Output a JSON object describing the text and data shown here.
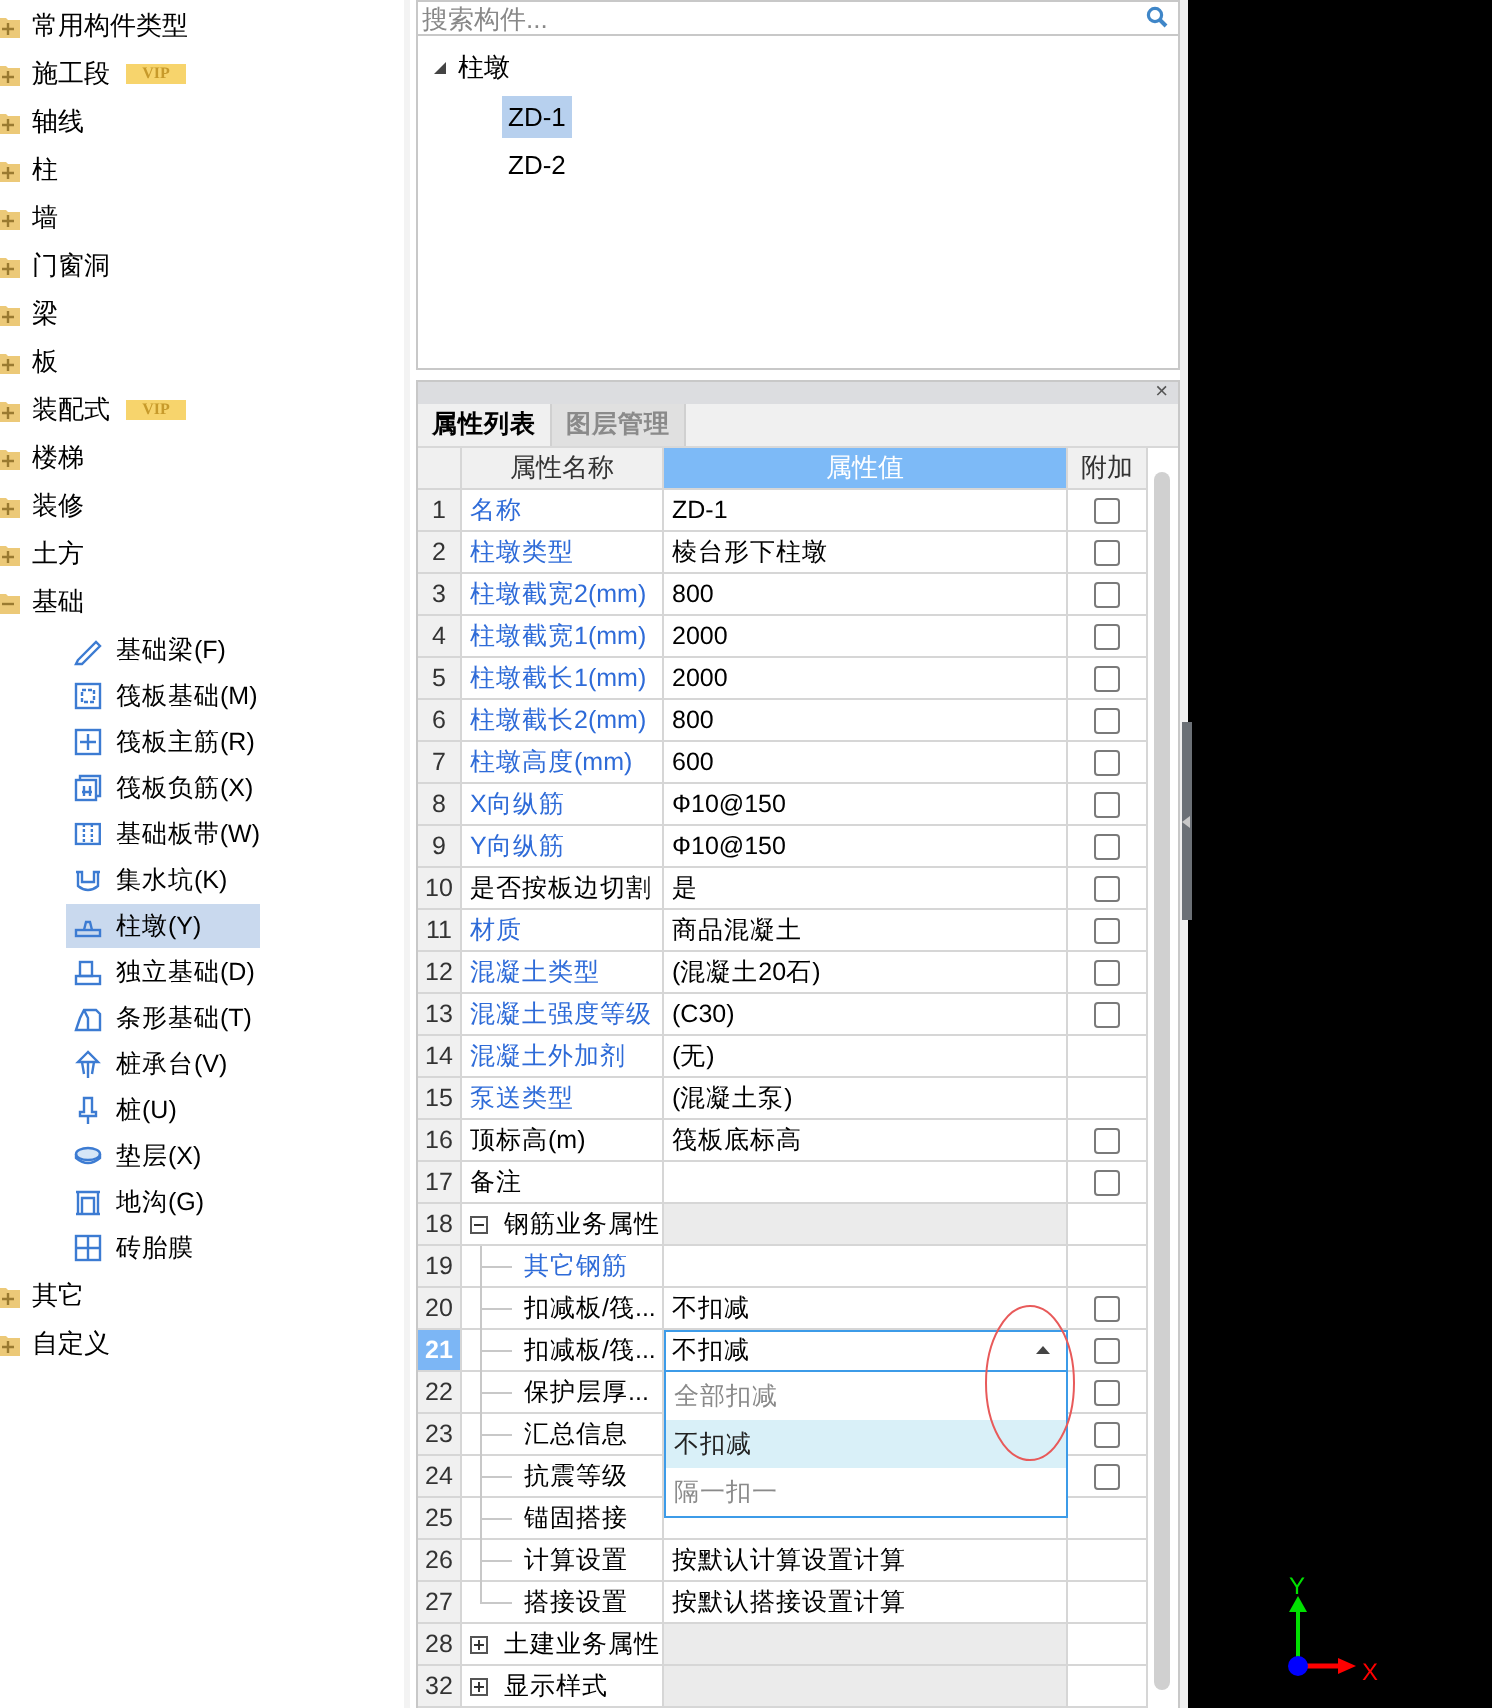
{
  "component_tree": {
    "categories": [
      {
        "label": "常用构件类型",
        "expanded": false
      },
      {
        "label": "施工段",
        "badge": "VIP",
        "expanded": false
      },
      {
        "label": "轴线",
        "expanded": false
      },
      {
        "label": "柱",
        "expanded": false
      },
      {
        "label": "墙",
        "expanded": false
      },
      {
        "label": "门窗洞",
        "expanded": false
      },
      {
        "label": "梁",
        "expanded": false
      },
      {
        "label": "板",
        "expanded": false
      },
      {
        "label": "装配式",
        "badge": "VIP",
        "expanded": false
      },
      {
        "label": "楼梯",
        "expanded": false
      },
      {
        "label": "装修",
        "expanded": false
      },
      {
        "label": "土方",
        "expanded": false
      },
      {
        "label": "基础",
        "expanded": true,
        "children": [
          {
            "label": "基础梁(F)",
            "selected": false
          },
          {
            "label": "筏板基础(M)",
            "selected": false
          },
          {
            "label": "筏板主筋(R)",
            "selected": false
          },
          {
            "label": "筏板负筋(X)",
            "selected": false
          },
          {
            "label": "基础板带(W)",
            "selected": false
          },
          {
            "label": "集水坑(K)",
            "selected": false
          },
          {
            "label": "柱墩(Y)",
            "selected": true
          },
          {
            "label": "独立基础(D)",
            "selected": false
          },
          {
            "label": "条形基础(T)",
            "selected": false
          },
          {
            "label": "桩承台(V)",
            "selected": false
          },
          {
            "label": "桩(U)",
            "selected": false
          },
          {
            "label": "垫层(X)",
            "selected": false
          },
          {
            "label": "地沟(G)",
            "selected": false
          },
          {
            "label": "砖胎膜",
            "selected": false
          }
        ]
      },
      {
        "label": "其它",
        "expanded": false
      },
      {
        "label": "自定义",
        "expanded": false
      }
    ]
  },
  "search": {
    "placeholder": "搜索构件..."
  },
  "component_list": {
    "label": "柱墩",
    "expanded": true,
    "children": [
      {
        "label": "ZD-1",
        "selected": true
      },
      {
        "label": "ZD-2",
        "selected": false
      }
    ]
  },
  "property_panel": {
    "close": "×",
    "tabs": [
      {
        "label": "属性列表",
        "selected": true
      },
      {
        "label": "图层管理",
        "selected": false
      }
    ],
    "columns": [
      {
        "label": "属性名称",
        "selected": false
      },
      {
        "label": "属性值",
        "selected": true
      },
      {
        "label": "附加",
        "selected": false
      }
    ],
    "rows": [
      {
        "kind": "property",
        "number": "1",
        "name": "名称",
        "color": "#2e6bd8",
        "value": "ZD-1",
        "checked": false,
        "selected": false
      },
      {
        "kind": "property",
        "number": "2",
        "name": "柱墩类型",
        "color": "#2e6bd8",
        "value": "棱台形下柱墩",
        "checked": false,
        "selected": false
      },
      {
        "kind": "property",
        "number": "3",
        "name": "柱墩截宽2(mm)",
        "color": "#2e6bd8",
        "value": "800",
        "checked": false,
        "selected": false
      },
      {
        "kind": "property",
        "number": "4",
        "name": "柱墩截宽1(mm)",
        "color": "#2e6bd8",
        "value": "2000",
        "checked": false,
        "selected": false
      },
      {
        "kind": "property",
        "number": "5",
        "name": "柱墩截长1(mm)",
        "color": "#2e6bd8",
        "value": "2000",
        "checked": false,
        "selected": false
      },
      {
        "kind": "property",
        "number": "6",
        "name": "柱墩截长2(mm)",
        "color": "#2e6bd8",
        "value": "800",
        "checked": false,
        "selected": false
      },
      {
        "kind": "property",
        "number": "7",
        "name": "柱墩高度(mm)",
        "color": "#2e6bd8",
        "value": "600",
        "checked": false,
        "selected": false
      },
      {
        "kind": "property",
        "number": "8",
        "name": "X向纵筋",
        "color": "#2e6bd8",
        "value": "Ф10@150",
        "checked": false,
        "selected": false
      },
      {
        "kind": "property",
        "number": "9",
        "name": "Y向纵筋",
        "color": "#2e6bd8",
        "value": "Ф10@150",
        "checked": false,
        "selected": false
      },
      {
        "kind": "property",
        "number": "10",
        "name": "是否按板边切割",
        "color": "#000000",
        "value": "是",
        "checked": false,
        "selected": false
      },
      {
        "kind": "property",
        "number": "11",
        "name": "材质",
        "color": "#2e6bd8",
        "value": "商品混凝土",
        "checked": false,
        "selected": false
      },
      {
        "kind": "property",
        "number": "12",
        "name": "混凝土类型",
        "color": "#2e6bd8",
        "value": "(混凝土20石)",
        "checked": false,
        "selected": false
      },
      {
        "kind": "property",
        "number": "13",
        "name": "混凝土强度等级",
        "color": "#2e6bd8",
        "value": "(C30)",
        "checked": false,
        "selected": false
      },
      {
        "kind": "property",
        "number": "14",
        "name": "混凝土外加剂",
        "color": "#2e6bd8",
        "value": "(无)",
        "selected": false
      },
      {
        "kind": "property",
        "number": "15",
        "name": "泵送类型",
        "color": "#2e6bd8",
        "value": "(混凝土泵)",
        "selected": false
      },
      {
        "kind": "property",
        "number": "16",
        "name": "顶标高(m)",
        "color": "#000000",
        "value": "筏板底标高",
        "checked": false,
        "selected": false
      },
      {
        "kind": "property",
        "number": "17",
        "name": "备注",
        "color": "#000000",
        "checked": false,
        "selected": false
      },
      {
        "kind": "group",
        "number": "18",
        "name": "钢筋业务属性",
        "expanded": true,
        "selected": false,
        "children": [
          {
            "kind": "property",
            "number": "19",
            "name": "其它钢筋",
            "color": "#2e6bd8",
            "selected": false
          },
          {
            "kind": "property",
            "number": "20",
            "name": "扣减板/筏...",
            "color": "#000000",
            "value": "不扣减",
            "checked": false,
            "selected": false
          },
          {
            "kind": "property",
            "number": "21",
            "name": "扣减板/筏...",
            "color": "#000000",
            "value": "不扣减",
            "checked": false,
            "selected": true,
            "options": [
              {
                "label": "全部扣减",
                "selected": false
              },
              {
                "label": "不扣减",
                "selected": true
              },
              {
                "label": "隔一扣一",
                "selected": false
              }
            ]
          },
          {
            "kind": "property",
            "number": "22",
            "name": "保护层厚...",
            "color": "#000000",
            "checked": false,
            "selected": false
          },
          {
            "kind": "property",
            "number": "23",
            "name": "汇总信息",
            "color": "#000000",
            "checked": false,
            "selected": false
          },
          {
            "kind": "property",
            "number": "24",
            "name": "抗震等级",
            "color": "#000000",
            "checked": false,
            "selected": false
          },
          {
            "kind": "property",
            "number": "25",
            "name": "锚固搭接",
            "color": "#000000",
            "selected": false
          },
          {
            "kind": "property",
            "number": "26",
            "name": "计算设置",
            "color": "#000000",
            "value": "按默认计算设置计算",
            "selected": false
          },
          {
            "kind": "property",
            "number": "27",
            "name": "搭接设置",
            "color": "#000000",
            "value": "按默认搭接设置计算",
            "selected": false
          }
        ]
      },
      {
        "kind": "group",
        "number": "28",
        "name": "土建业务属性",
        "expanded": false,
        "selected": false
      },
      {
        "kind": "group",
        "number": "32",
        "name": "显示样式",
        "expanded": false,
        "selected": false
      }
    ]
  },
  "viewport": {
    "axis": {
      "y_label": "Y",
      "x_label": "X"
    }
  }
}
